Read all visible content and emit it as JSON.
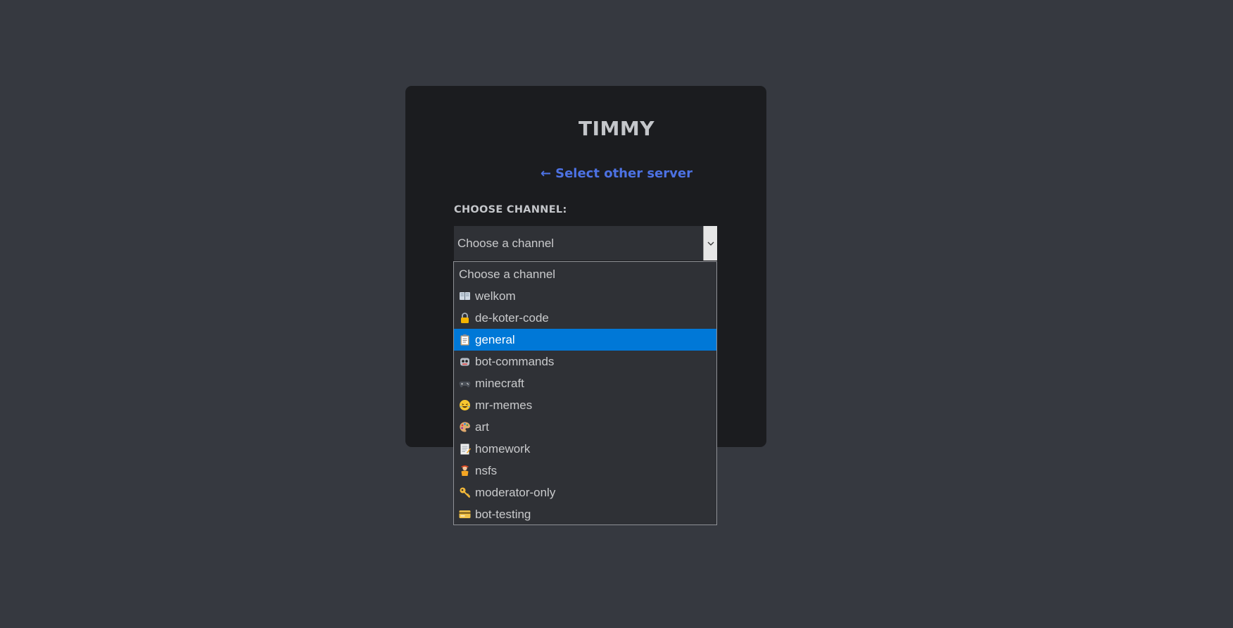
{
  "card": {
    "title": "TIMMY",
    "back_link": "Select other server",
    "channel_label": "CHOOSE CHANNEL:"
  },
  "select": {
    "value": "Choose a channel"
  },
  "dropdown": {
    "options": [
      {
        "label": "Choose a channel",
        "icon": ""
      },
      {
        "label": "welkom",
        "icon": "open-book-icon"
      },
      {
        "label": "de-koter-code",
        "icon": "lock-icon"
      },
      {
        "label": "general",
        "icon": "clipboard-icon",
        "selected": true
      },
      {
        "label": "bot-commands",
        "icon": "robot-icon"
      },
      {
        "label": "minecraft",
        "icon": "game-controller-icon"
      },
      {
        "label": "mr-memes",
        "icon": "laughing-face-icon"
      },
      {
        "label": "art",
        "icon": "palette-icon"
      },
      {
        "label": "homework",
        "icon": "memo-icon"
      },
      {
        "label": "nsfs",
        "icon": "person-icon"
      },
      {
        "label": "moderator-only",
        "icon": "key-icon"
      },
      {
        "label": "bot-testing",
        "icon": "card-icon"
      }
    ]
  },
  "colors": {
    "background": "#363940",
    "card": "#1b1c1f",
    "link": "#4d72e3",
    "selected": "#0078d7"
  }
}
